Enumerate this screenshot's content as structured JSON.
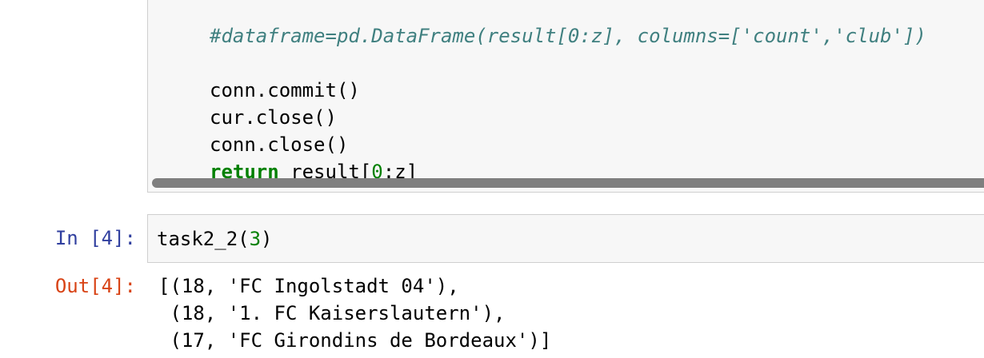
{
  "top_cell": {
    "comment_line": "#dataframe=pd.DataFrame(result[0:z], columns=['count','club'])",
    "line_commit": "conn.commit()",
    "line_cur_close": "cur.close()",
    "line_conn_close": "conn.close()",
    "return_kw": "return",
    "return_pre": " result[",
    "return_num": "0",
    "return_post": ":z]"
  },
  "input_cell": {
    "prompt": "In [4]:",
    "code_pre": "task2_2(",
    "code_num": "3",
    "code_post": ")"
  },
  "output_cell": {
    "prompt": "Out[4]:",
    "lines": [
      "[(18, 'FC Ingolstadt 04'),",
      " (18, '1. FC Kaiserslautern'),",
      " (17, 'FC Girondins de Bordeaux')]"
    ]
  },
  "colors": {
    "comment": "#408080",
    "keyword": "#008000",
    "prompt_in": "#303f9f",
    "prompt_out": "#d84315",
    "cell_bg": "#f7f7f7"
  }
}
